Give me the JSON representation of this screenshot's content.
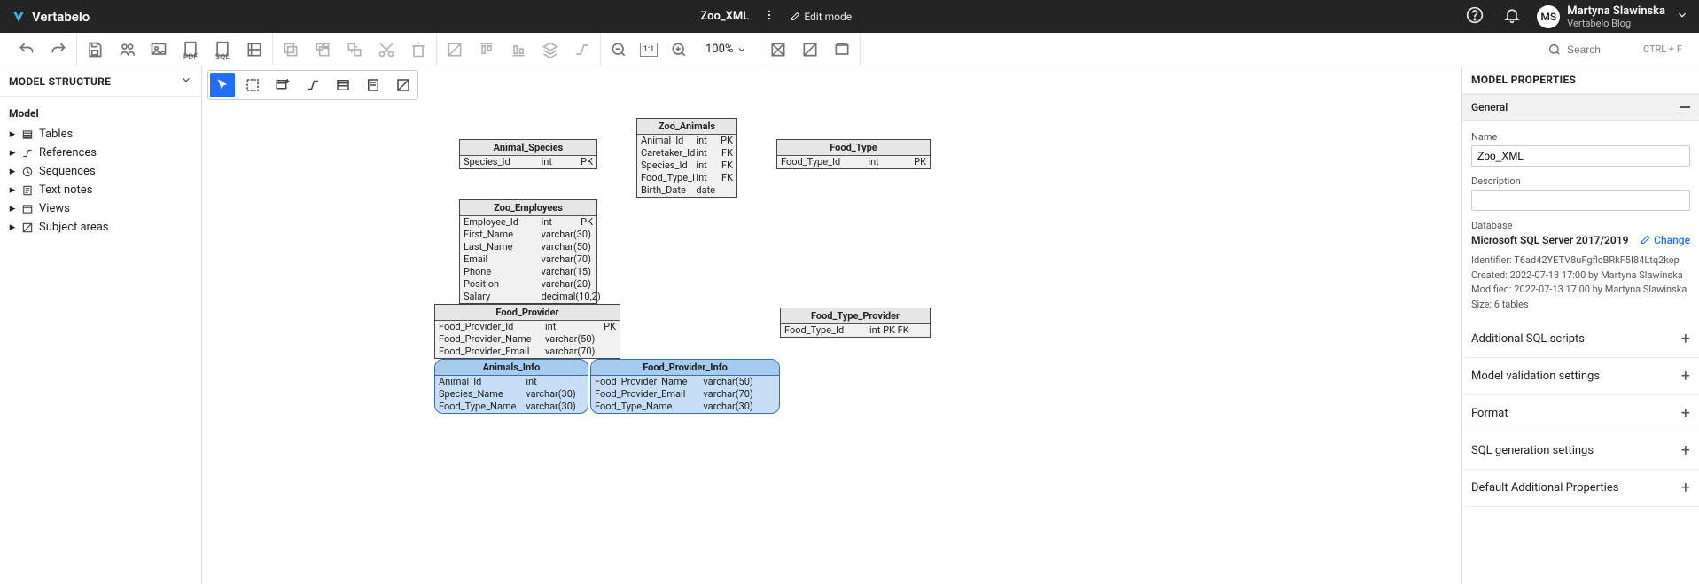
{
  "app": {
    "brand": "Vertabelo"
  },
  "header": {
    "model_name": "Zoo_XML",
    "edit_mode": "Edit mode",
    "user": {
      "initials": "MS",
      "name": "Martyna Slawinska",
      "org": "Vertabelo Blog"
    },
    "search_placeholder": "Search",
    "search_shortcut": "CTRL + F"
  },
  "zoom": {
    "level": "100%",
    "ratio": "1:1"
  },
  "left": {
    "title": "MODEL STRUCTURE",
    "root": "Model",
    "items": [
      "Tables",
      "References",
      "Sequences",
      "Text notes",
      "Views",
      "Subject areas"
    ]
  },
  "right": {
    "title": "MODEL PROPERTIES",
    "general": "General",
    "name_label": "Name",
    "name_value": "Zoo_XML",
    "desc_label": "Description",
    "db_label": "Database",
    "db_value": "Microsoft SQL Server 2017/2019",
    "change": "Change",
    "identifier": "Identifier: T6ad42YETV8uFgflcBRkF5I84Ltq2kep",
    "created": "Created: 2022-07-13 17:00 by Martyna Slawinska",
    "modified": "Modified: 2022-07-13 17:00 by Martyna Slawinska",
    "size": "Size: 6 tables",
    "sections": [
      "Additional SQL scripts",
      "Model validation settings",
      "Format",
      "SQL generation settings",
      "Default Additional Properties"
    ]
  },
  "entities": {
    "animal_species": {
      "title": "Animal_Species",
      "rows": [
        [
          "Species_Id",
          "int",
          "PK"
        ]
      ]
    },
    "zoo_animals": {
      "title": "Zoo_Animals",
      "rows": [
        [
          "Animal_Id",
          "int",
          "PK"
        ],
        [
          "Caretaker_Id",
          "int",
          "FK"
        ],
        [
          "Species_Id",
          "int",
          "FK"
        ],
        [
          "Food_Type_I",
          "int",
          "FK"
        ],
        [
          "Birth_Date",
          "date",
          ""
        ]
      ]
    },
    "food_type": {
      "title": "Food_Type",
      "rows": [
        [
          "Food_Type_Id",
          "int",
          "PK"
        ]
      ]
    },
    "zoo_employees": {
      "title": "Zoo_Employees",
      "rows": [
        [
          "Employee_Id",
          "int",
          "PK"
        ],
        [
          "First_Name",
          "varchar(30)",
          ""
        ],
        [
          "Last_Name",
          "varchar(50)",
          ""
        ],
        [
          "Email",
          "varchar(70)",
          ""
        ],
        [
          "Phone",
          "varchar(15)",
          ""
        ],
        [
          "Position",
          "varchar(20)",
          ""
        ],
        [
          "Salary",
          "decimal(10,2)",
          ""
        ]
      ]
    },
    "food_provider": {
      "title": "Food_Provider",
      "rows": [
        [
          "Food_Provider_Id",
          "int",
          "PK"
        ],
        [
          "Food_Provider_Name",
          "varchar(50)",
          ""
        ],
        [
          "Food_Provider_Email",
          "varchar(70)",
          ""
        ]
      ]
    },
    "food_type_provider": {
      "title": "Food_Type_Provider",
      "rows": [
        [
          "Food_Type_Id",
          "int PK FK",
          ""
        ]
      ]
    },
    "animals_info": {
      "title": "Animals_Info",
      "rows": [
        [
          "Animal_Id",
          "int",
          ""
        ],
        [
          "Species_Name",
          "varchar(30)",
          ""
        ],
        [
          "Food_Type_Name",
          "varchar(30)",
          ""
        ]
      ]
    },
    "food_provider_info": {
      "title": "Food_Provider_Info",
      "rows": [
        [
          "Food_Provider_Name",
          "varchar(50)",
          ""
        ],
        [
          "Food_Provider_Email",
          "varchar(70)",
          ""
        ],
        [
          "Food_Type_Name",
          "varchar(30)",
          ""
        ]
      ]
    }
  }
}
